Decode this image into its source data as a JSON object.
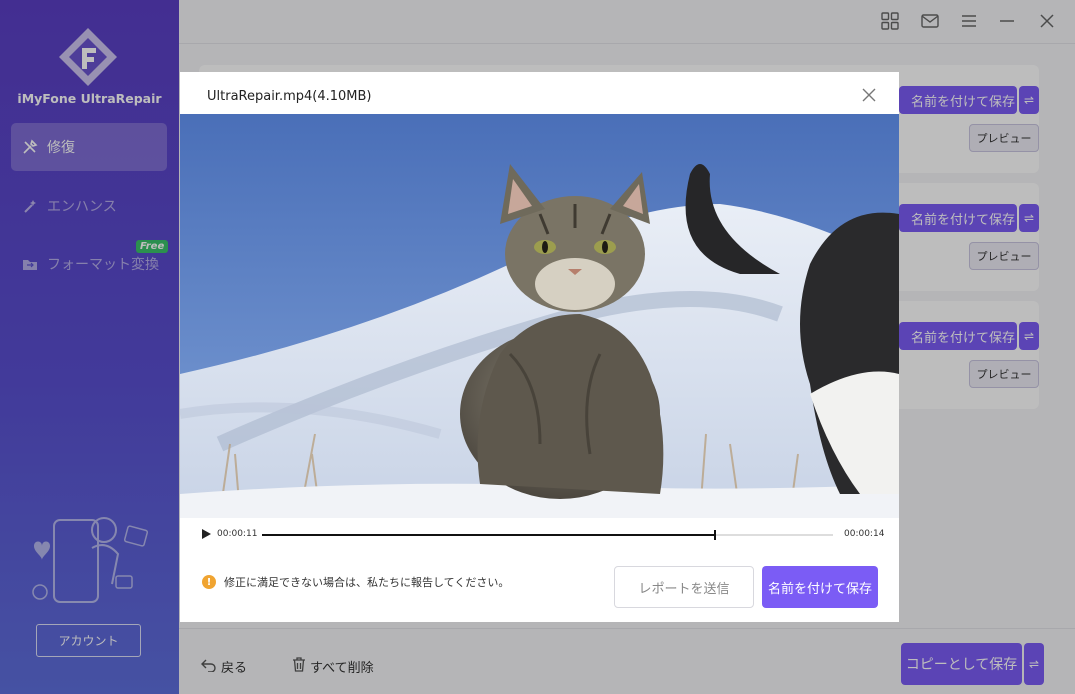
{
  "app": {
    "name": "iMyFone UltraRepair",
    "brand_color": "#5b3fc4",
    "accent_color": "#7b5cf5"
  },
  "sidebar": {
    "items": [
      {
        "label": "修復",
        "icon": "repair-tools-icon",
        "active": true
      },
      {
        "label": "エンハンス",
        "icon": "magic-wand-icon",
        "active": false
      },
      {
        "label": "フォーマット変換",
        "icon": "folder-convert-icon",
        "active": false,
        "badge": "Free"
      }
    ],
    "account_label": "アカウント"
  },
  "topbar": {
    "icons": [
      "grid-icon",
      "mail-icon",
      "menu-icon",
      "minimize-icon",
      "close-icon"
    ]
  },
  "cards": [
    {
      "save_label": "名前を付けて保存",
      "preview_label": "プレビュー"
    },
    {
      "save_label": "名前を付けて保存",
      "preview_label": "プレビュー"
    },
    {
      "save_label": "名前を付けて保存",
      "preview_label": "プレビュー"
    }
  ],
  "bottombar": {
    "back_label": "戻る",
    "delete_all_label": "すべて削除",
    "copy_save_label": "コピーとして保存"
  },
  "modal": {
    "title": "UltraRepair.mp4(4.10MB)",
    "current_time": "00:00:11",
    "total_time": "00:00:14",
    "progress": 0.793,
    "warning_text": "修正に満足できない場合は、私たちに報告してください。",
    "report_label": "レポートを送信",
    "save_label": "名前を付けて保存"
  }
}
